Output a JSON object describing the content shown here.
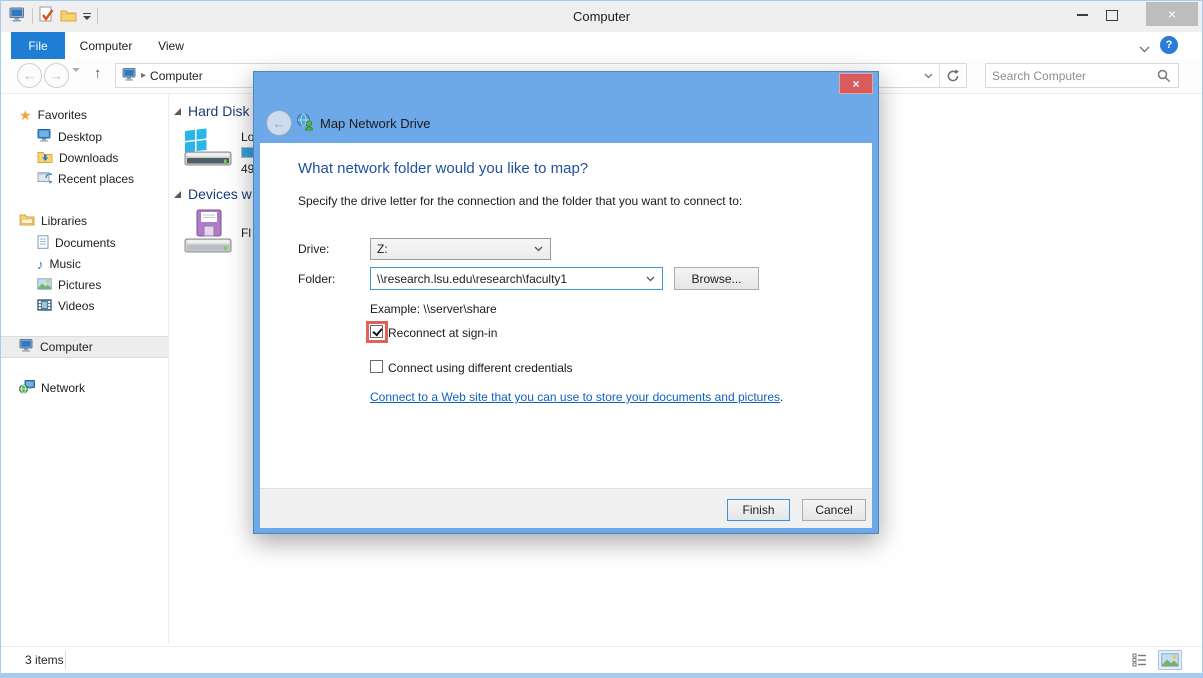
{
  "window": {
    "title": "Computer"
  },
  "ribbon": {
    "tabs": [
      "File",
      "Computer",
      "View"
    ],
    "help_glyph": "?"
  },
  "address_bar": {
    "breadcrumb": "Computer",
    "search_placeholder": "Search Computer"
  },
  "glyphs": {
    "back": "←",
    "forward": "→",
    "up": "↑",
    "breadcrumb_arrow": "▸",
    "star": "★",
    "music_note": "♪",
    "close": "×",
    "minimize_label": "",
    "dialog_back": "←"
  },
  "sidebar": {
    "favorites": {
      "label": "Favorites",
      "items": [
        "Desktop",
        "Downloads",
        "Recent places"
      ]
    },
    "libraries": {
      "label": "Libraries",
      "items": [
        "Documents",
        "Music",
        "Pictures",
        "Videos"
      ]
    },
    "computer": {
      "label": "Computer"
    },
    "network": {
      "label": "Network"
    }
  },
  "content": {
    "group1_label": "Hard Disk",
    "group2_label": "Devices w",
    "drive_name_fragment": "Lo",
    "drive_size_fragment": "49",
    "floppy_name_fragment": "Fl"
  },
  "dialog": {
    "title": "Map Network Drive",
    "heading": "What network folder would you like to map?",
    "subheading": "Specify the drive letter for the connection and the folder that you want to connect to:",
    "drive_label": "Drive:",
    "drive_value": "Z:",
    "folder_label": "Folder:",
    "folder_value": "\\\\research.lsu.edu\\research\\faculty1",
    "browse_label": "Browse...",
    "example": "Example: \\\\server\\share",
    "reconnect_checkbox": {
      "label": "Reconnect at sign-in",
      "checked": true
    },
    "credentials_checkbox": {
      "label": "Connect using different credentials",
      "checked": false
    },
    "link_text": "Connect to a Web site that you can use to store your documents and pictures",
    "link_suffix": ".",
    "finish_label": "Finish",
    "cancel_label": "Cancel"
  },
  "statusbar": {
    "items_count": "3 items"
  },
  "colors": {
    "dialog_chrome": "#6da8e8",
    "dialog_heading": "#2050a0",
    "file_tab": "#1d7ed3",
    "close_red": "#d95c5c",
    "annotation_red": "#df6158",
    "link": "#0f62c4",
    "group_header": "#1b3c77",
    "capacity_bar": "#33a1de"
  }
}
